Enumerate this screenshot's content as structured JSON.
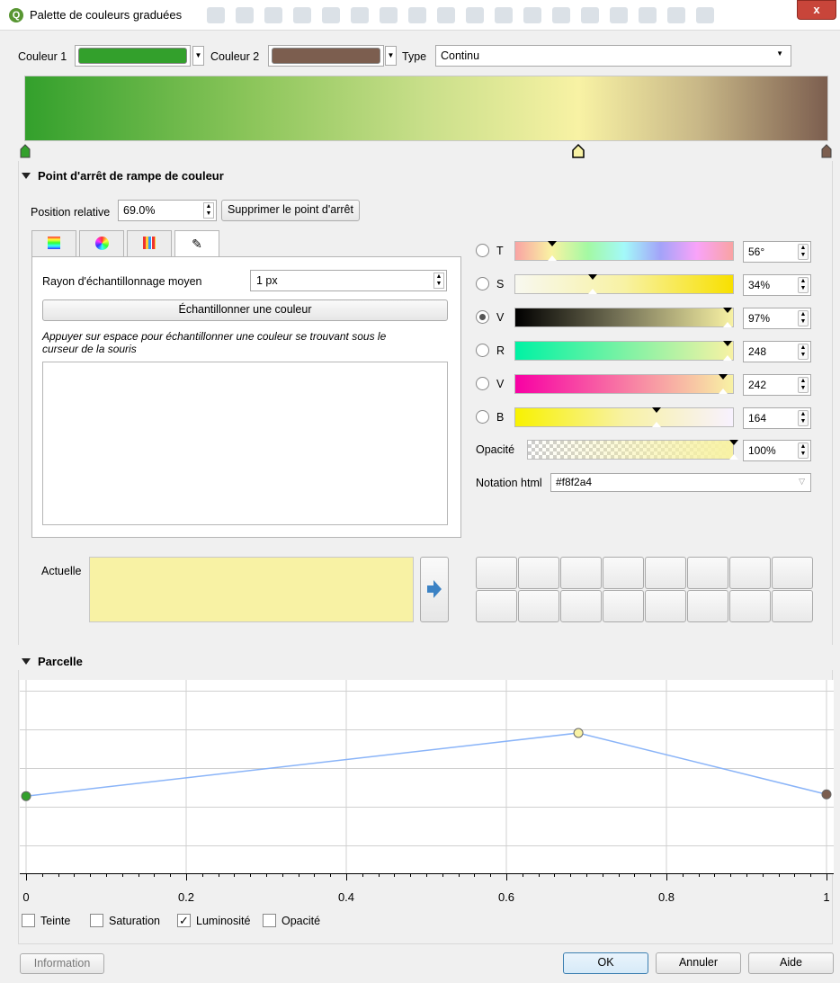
{
  "window": {
    "title": "Palette de couleurs graduées",
    "close_label": "x"
  },
  "top": {
    "color1_label": "Couleur 1",
    "color1_hex": "#33a02c",
    "color2_label": "Couleur 2",
    "color2_hex": "#7c5e4f",
    "type_label": "Type",
    "type_value": "Continu"
  },
  "stop_section": {
    "title": "Point d'arrêt de rampe de couleur",
    "position_label": "Position relative",
    "position_value": "69.0%",
    "delete_button": "Supprimer le point d'arrêt"
  },
  "sampler": {
    "radius_label": "Rayon d'échantillonnage moyen",
    "radius_value": "1 px",
    "sample_button": "Échantillonner une couleur",
    "hint": "Appuyer sur espace pour échantillonner une couleur se trouvant sous le curseur de la souris"
  },
  "tabs": [
    "ramp-tab-icon",
    "wheel-tab-icon",
    "swatches-tab-icon",
    "picker-tab-icon"
  ],
  "channels": [
    {
      "label": "T",
      "value": "56°",
      "level": 0.15
    },
    {
      "label": "S",
      "value": "34%",
      "level": 0.34
    },
    {
      "label": "V",
      "value": "97%",
      "level": 0.97
    },
    {
      "label": "R",
      "value": "248",
      "level": 0.97
    },
    {
      "label": "V",
      "value": "242",
      "level": 0.95
    },
    {
      "label": "B",
      "value": "164",
      "level": 0.64
    }
  ],
  "opacity": {
    "label": "Opacité",
    "value": "100%",
    "level": 1.0
  },
  "html": {
    "label": "Notation html",
    "value": "#f8f2a4"
  },
  "current": {
    "label": "Actuelle",
    "color": "#f8f2a4"
  },
  "plot_section": {
    "title": "Parcelle"
  },
  "chart_data": {
    "type": "line",
    "x": [
      0,
      0.69,
      1
    ],
    "series": [
      {
        "values": [
          0.44,
          0.8,
          0.45
        ]
      }
    ],
    "xlim": [
      0,
      1
    ],
    "x_ticks": [
      "0",
      "0.2",
      "0.4",
      "0.6",
      "0.8",
      "1"
    ],
    "point_colors": [
      "#33a02c",
      "#f8f2a4",
      "#7c5e4f"
    ],
    "line_color": "#8ab4f8"
  },
  "plot_checks": [
    {
      "label": "Teinte",
      "checked": false
    },
    {
      "label": "Saturation",
      "checked": false
    },
    {
      "label": "Luminosité",
      "checked": true
    },
    {
      "label": "Opacité",
      "checked": false
    }
  ],
  "buttons": {
    "info": "Information",
    "ok": "OK",
    "cancel": "Annuler",
    "help": "Aide"
  }
}
